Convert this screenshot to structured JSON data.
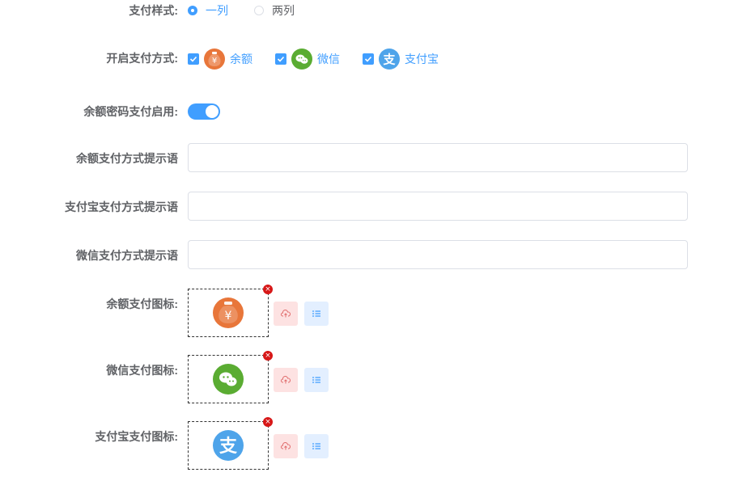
{
  "form": {
    "pay_style": {
      "label": "支付样式:",
      "options": [
        {
          "label": "一列",
          "checked": true
        },
        {
          "label": "两列",
          "checked": false
        }
      ]
    },
    "pay_methods": {
      "label": "开启支付方式:",
      "options": [
        {
          "label": "余额",
          "checked": true,
          "icon": "money-bag-icon",
          "color": "#e8763a"
        },
        {
          "label": "微信",
          "checked": true,
          "icon": "wechat-icon",
          "color": "#5aac32"
        },
        {
          "label": "支付宝",
          "checked": true,
          "icon": "alipay-icon",
          "color": "#4ea4ea"
        }
      ]
    },
    "balance_password": {
      "label": "余额密码支付启用:",
      "enabled": true
    },
    "balance_tip": {
      "label": "余额支付方式提示语",
      "value": "",
      "placeholder": ""
    },
    "alipay_tip": {
      "label": "支付宝支付方式提示语",
      "value": "",
      "placeholder": ""
    },
    "wechat_tip": {
      "label": "微信支付方式提示语",
      "value": "",
      "placeholder": ""
    },
    "balance_icon": {
      "label": "余额支付图标:",
      "icon": "money-bag-icon"
    },
    "wechat_icon": {
      "label": "微信支付图标:",
      "icon": "wechat-icon"
    },
    "alipay_icon": {
      "label": "支付宝支付图标:",
      "icon": "alipay-icon"
    }
  },
  "colors": {
    "primary": "#409eff",
    "remove": "#d71717",
    "balance": "#e8763a",
    "wechat": "#5aac32",
    "alipay": "#4ea4ea"
  }
}
